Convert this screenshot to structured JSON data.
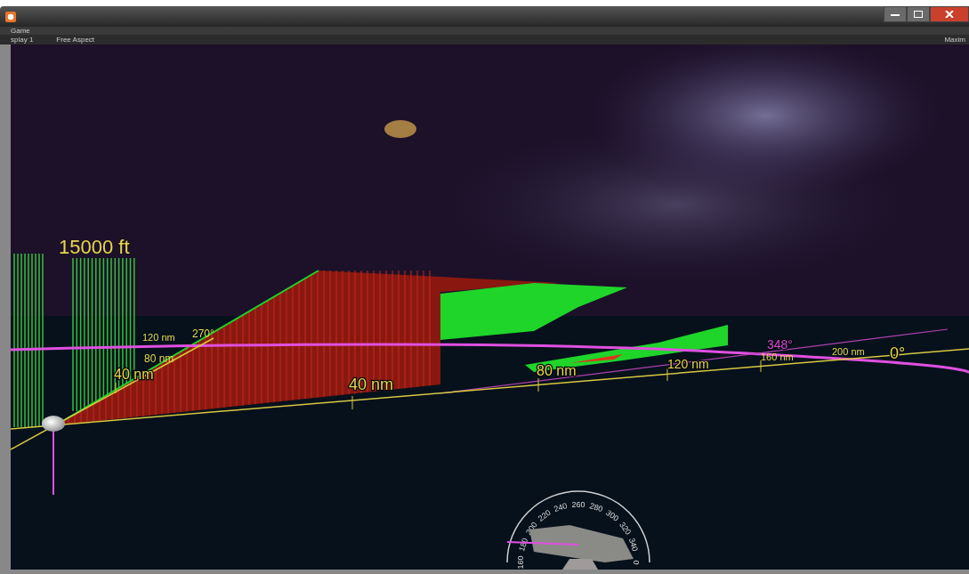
{
  "window": {
    "tab": "Game",
    "toolbar": {
      "display": "splay 1",
      "aspect": "Free Aspect",
      "right_label": "Maxim"
    }
  },
  "scene": {
    "altitude_label": "15000 ft",
    "labels": [
      {
        "text": "270°",
        "color": "#e8d84a"
      },
      {
        "text": "120 nm",
        "color": "#e8d84a"
      },
      {
        "text": "80 nm",
        "color": "#e8d84a"
      },
      {
        "text": "40 nm",
        "color": "#e8d84a"
      },
      {
        "text": "40 nm",
        "color": "#e8d84a"
      },
      {
        "text": "80 nm",
        "color": "#e8d84a"
      },
      {
        "text": "120 nm",
        "color": "#e8d84a"
      },
      {
        "text": "160 nm",
        "color": "#e8d84a"
      },
      {
        "text": "348°",
        "color": "#d84ad8"
      },
      {
        "text": "200 nm",
        "color": "#e8d84a"
      },
      {
        "text": "0°",
        "color": "#e8d84a"
      }
    ],
    "compass": {
      "ticks": [
        "160",
        "180",
        "200",
        "220",
        "240",
        "260",
        "280",
        "300",
        "320",
        "340",
        "0"
      ]
    }
  }
}
